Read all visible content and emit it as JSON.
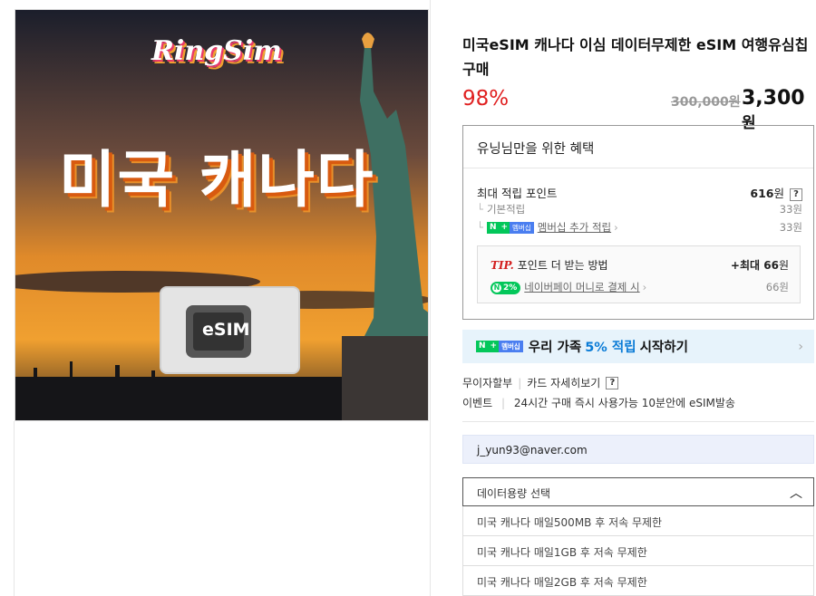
{
  "product": {
    "title": "미국eSIM 캐나다 이심 데이터무제한 eSIM 여행유심칩 구매",
    "discount": "98%",
    "original_price": "300,000원",
    "sale_price": "3,300",
    "sale_unit": "원"
  },
  "image": {
    "brand": "RingSim",
    "headline": "미국 캐나다",
    "card_label": "eSIM"
  },
  "benefits": {
    "header": "유닝님만을 위한 혜택",
    "max_points_label": "최대 적립 포인트",
    "max_points_value": "616",
    "max_points_unit": "원",
    "help": "?",
    "basic_label": "기본적립",
    "basic_value": "33원",
    "membership_badge_n": "N",
    "membership_badge_plus": "+",
    "membership_badge_text": "멤버십",
    "membership_label": "멤버십 추가 적립",
    "membership_value": "33원",
    "tip_label": "TIP.",
    "tip_text": "포인트 더 받는 방법",
    "tip_max_prefix": "+최대",
    "tip_max_value": "66",
    "tip_max_unit": "원",
    "pay_badge_icon": "N",
    "pay_badge": "2%",
    "pay_label": "네이버페이 머니로 결제 시",
    "pay_value": "66원"
  },
  "promo": {
    "prefix": "우리 가족",
    "highlight": "5% 적립",
    "suffix": "시작하기"
  },
  "info": {
    "installment": "무이자할부",
    "card_details": "카드 자세히보기",
    "help": "?",
    "event_label": "이벤트",
    "event_text": "24시간 구매 즉시 사용가능 10분안에 eSIM발송"
  },
  "email": "j_yun93@naver.com",
  "select": {
    "label": "데이터용량 선택",
    "options": [
      "미국 캐나다 매일500MB 후 저속 무제한",
      "미국 캐나다 매일1GB 후 저속 무제한",
      "미국 캐나다 매일2GB 후 저속 무제한"
    ]
  },
  "colors": {
    "discount": "#e02020",
    "promo_bg": "#e7f3fb",
    "promo_highlight": "#0a7bd6",
    "naver_green": "#03c75a"
  }
}
